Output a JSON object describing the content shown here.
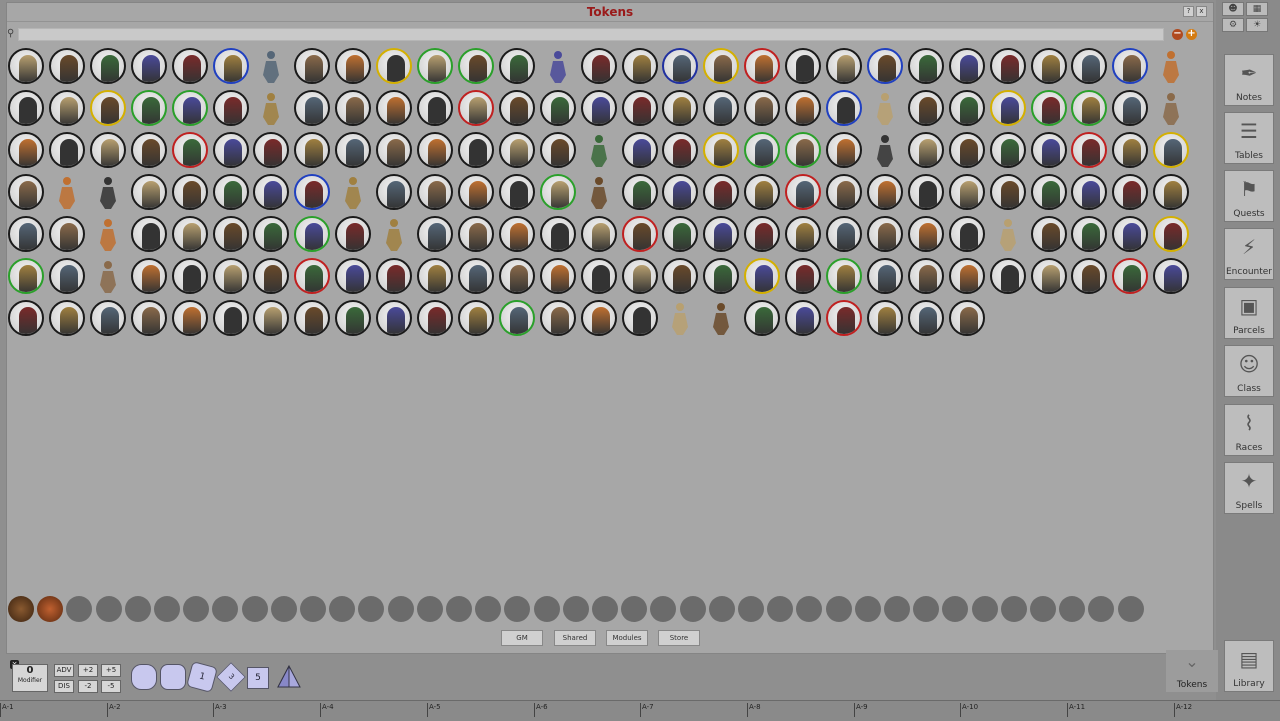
{
  "window": {
    "title": "Tokens"
  },
  "toolbar": {
    "help": "?",
    "close": "x"
  },
  "search": {
    "placeholder": ""
  },
  "token_grid": {
    "rows": [
      [
        "#ffffff",
        "#ffffff",
        "#ffffff",
        "#ffffff",
        "#ffffff",
        "#2040c0",
        "loose",
        "#ffffff",
        "#ffffff",
        "#d4b000",
        "#2aa02a",
        "#2aa02a",
        "#ffffff",
        "loose",
        "#ffffff",
        "#ffffff",
        "#2030a0",
        "#d4b000",
        "#c02020",
        "#ffffff",
        "#ffffff",
        "#2040c0",
        "#ffffff",
        "#ffffff",
        "#ffffff",
        "#ffffff",
        "#ffffff",
        "#2040c0",
        "loose"
      ],
      [
        "#ffffff",
        "#ffffff",
        "#d4b000",
        "#2aa02a",
        "#2aa02a",
        "#ffffff",
        "loose",
        "#ffffff",
        "#ffffff",
        "#ffffff",
        "#ffffff",
        "#c02020",
        "#ffffff",
        "#ffffff",
        "#ffffff",
        "#ffffff",
        "#ffffff",
        "#ffffff",
        "#ffffff",
        "#ffffff",
        "#2040c0",
        "loose",
        "#ffffff",
        "#ffffff",
        "#d4b000",
        "#2aa02a",
        "#2aa02a",
        "#ffffff",
        "loose"
      ],
      [
        "#ffffff",
        "#ffffff",
        "#ffffff",
        "#ffffff",
        "#c02020",
        "#ffffff",
        "#ffffff",
        "#ffffff",
        "#ffffff",
        "#ffffff",
        "#ffffff",
        "#ffffff",
        "#ffffff",
        "#ffffff",
        "loose",
        "#ffffff",
        "#ffffff",
        "#d4b000",
        "#2aa02a",
        "#2aa02a",
        "#ffffff",
        "loose",
        "#ffffff",
        "#ffffff",
        "#ffffff",
        "#ffffff",
        "#c02020",
        "#ffffff",
        "#d4b000"
      ],
      [
        "#ffffff",
        "loose",
        "loose",
        "#ffffff",
        "#ffffff",
        "#ffffff",
        "#ffffff",
        "#2040c0",
        "loose",
        "#ffffff",
        "#ffffff",
        "#ffffff",
        "#ffffff",
        "#2aa02a",
        "loose",
        "#ffffff",
        "#ffffff",
        "#ffffff",
        "#ffffff",
        "#c02020",
        "#ffffff",
        "#ffffff",
        "#ffffff",
        "#ffffff",
        "#ffffff",
        "#ffffff",
        "#ffffff",
        "#ffffff",
        "#ffffff"
      ],
      [
        "#ffffff",
        "#ffffff",
        "loose",
        "#ffffff",
        "#ffffff",
        "#ffffff",
        "#ffffff",
        "#2aa02a",
        "#ffffff",
        "loose",
        "#ffffff",
        "#ffffff",
        "#ffffff",
        "#ffffff",
        "#ffffff",
        "#c02020",
        "#ffffff",
        "#ffffff",
        "#ffffff",
        "#ffffff",
        "#ffffff",
        "#ffffff",
        "#ffffff",
        "#ffffff",
        "loose",
        "#ffffff",
        "#ffffff",
        "#ffffff",
        "#d4b000"
      ],
      [
        "#2aa02a",
        "#ffffff",
        "loose",
        "#ffffff",
        "#ffffff",
        "#ffffff",
        "#ffffff",
        "#c02020",
        "#ffffff",
        "#ffffff",
        "#ffffff",
        "#ffffff",
        "#ffffff",
        "#ffffff",
        "#ffffff",
        "#ffffff",
        "#ffffff",
        "#ffffff",
        "#d4b000",
        "#ffffff",
        "#2aa02a",
        "#ffffff",
        "#ffffff",
        "#ffffff",
        "#ffffff",
        "#ffffff",
        "#ffffff",
        "#c02020",
        "#ffffff"
      ],
      [
        "#ffffff",
        "#ffffff",
        "#ffffff",
        "#ffffff",
        "#ffffff",
        "#ffffff",
        "#ffffff",
        "#ffffff",
        "#ffffff",
        "#ffffff",
        "#ffffff",
        "#ffffff",
        "#2aa02a",
        "#ffffff",
        "#ffffff",
        "#ffffff",
        "loose",
        "loose",
        "#ffffff",
        "#ffffff",
        "#c02020",
        "#ffffff",
        "#ffffff",
        "#ffffff"
      ]
    ],
    "fig_colors": [
      "#b8a070",
      "#6a4a2a",
      "#3a6a3a",
      "#4a4a9a",
      "#7a2a2a",
      "#a08040",
      "#556677",
      "#8a6a4a",
      "#c07030",
      "#333333"
    ]
  },
  "stash": {
    "slot_count": 39
  },
  "tabs": [
    {
      "label": "GM"
    },
    {
      "label": "Shared"
    },
    {
      "label": "Modules"
    },
    {
      "label": "Store"
    }
  ],
  "sidebar": {
    "items": [
      {
        "label": "Notes",
        "icon": "quill-icon"
      },
      {
        "label": "Tables",
        "icon": "list-icon"
      },
      {
        "label": "Quests",
        "icon": "flag-icon"
      },
      {
        "label": "Encounter",
        "icon": "lightning-icon"
      },
      {
        "label": "Parcels",
        "icon": "box-icon"
      },
      {
        "label": "Class",
        "icon": "portrait-icon"
      },
      {
        "label": "Races",
        "icon": "dna-icon"
      },
      {
        "label": "Spells",
        "icon": "wand-icon"
      }
    ],
    "library": "Library",
    "tokens": "Tokens"
  },
  "dice_bar": {
    "modifier_value": "0",
    "modifier_label": "Modifier",
    "adv": "ADV",
    "dis": "DIS",
    "plus2": "+2",
    "plus5": "+5",
    "minus2": "-2",
    "minus5": "-5",
    "dice": [
      "",
      "",
      "1",
      "3",
      "5",
      ""
    ]
  },
  "ruler": [
    "A-1",
    "A-2",
    "A-3",
    "A-4",
    "A-5",
    "A-6",
    "A-7",
    "A-8",
    "A-9",
    "A-10",
    "A-11",
    "A-12"
  ]
}
